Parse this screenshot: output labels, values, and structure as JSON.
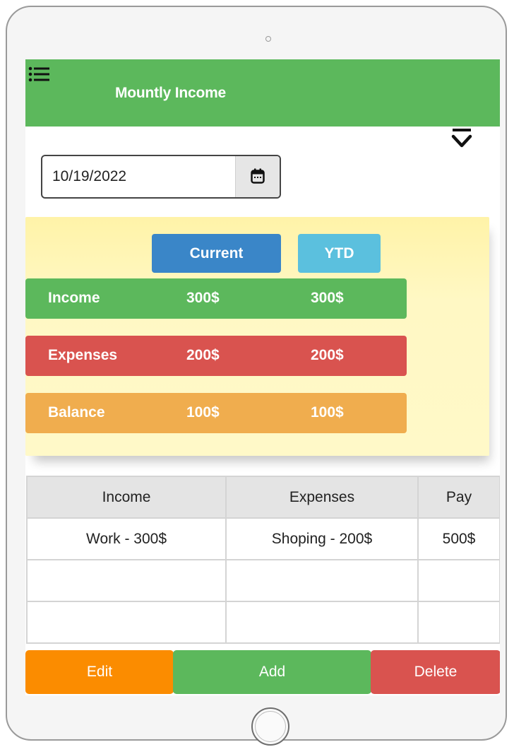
{
  "header": {
    "title": "Mountly Income"
  },
  "date_picker": {
    "value": "10/19/2022"
  },
  "summary": {
    "tabs": [
      {
        "label": "Current",
        "color": "#3a86c8"
      },
      {
        "label": "YTD",
        "color": "#5bc0de"
      }
    ],
    "rows": [
      {
        "label": "Income",
        "current": "300$",
        "ytd": "300$",
        "color": "#5cb85c"
      },
      {
        "label": "Expenses",
        "current": "200$",
        "ytd": "200$",
        "color": "#d9534f"
      },
      {
        "label": "Balance",
        "current": "100$",
        "ytd": "100$",
        "color": "#f0ad4e"
      }
    ]
  },
  "table": {
    "headers": [
      "Income",
      "Expenses",
      "Pay"
    ],
    "rows": [
      [
        "Work - 300$",
        "Shoping - 200$",
        "500$"
      ],
      [
        "",
        "",
        ""
      ],
      [
        "",
        "",
        ""
      ]
    ]
  },
  "actions": {
    "edit": "Edit",
    "add": "Add",
    "delete": "Delete"
  },
  "icons": {
    "menu": "menu-list-icon",
    "collapse": "chevron-collapse-icon",
    "calendar": "calendar-icon"
  }
}
